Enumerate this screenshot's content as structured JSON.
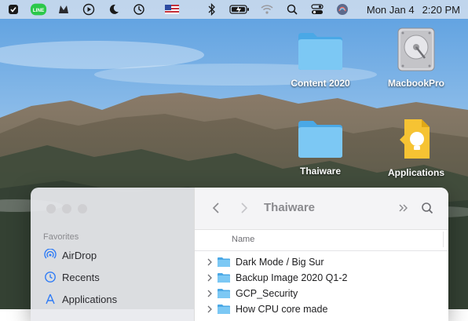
{
  "menubar": {
    "line_label": "LINE",
    "date": "Mon Jan 4",
    "time": "2:20 PM",
    "icons": [
      "checkbox-icon",
      "line-icon",
      "malwarebytes-icon",
      "play-icon",
      "moon-icon",
      "time-machine-icon",
      "flag-icon",
      "bluetooth-icon",
      "battery-icon",
      "wifi-icon",
      "search-icon",
      "control-center-icon",
      "siri-icon"
    ]
  },
  "desktop": {
    "icons": [
      {
        "label": "Content 2020",
        "icon": "folder-icon"
      },
      {
        "label": "MacbookPro",
        "icon": "hard-drive-icon"
      },
      {
        "label": "Thaiware",
        "icon": "folder-icon"
      },
      {
        "label": "Applications",
        "icon": "applications-icon"
      }
    ]
  },
  "finder": {
    "title": "Thaiware",
    "sidebar": {
      "section": "Favorites",
      "items": [
        {
          "label": "AirDrop",
          "icon": "airdrop-icon"
        },
        {
          "label": "Recents",
          "icon": "clock-icon"
        },
        {
          "label": "Applications",
          "icon": "applications-icon"
        }
      ]
    },
    "column_header": "Name",
    "rows": [
      {
        "name": "Dark Mode / Big Sur"
      },
      {
        "name": "Backup Image 2020 Q1-2"
      },
      {
        "name": "GCP_Security"
      },
      {
        "name": "How CPU core made"
      }
    ]
  },
  "colors": {
    "accent": "#2f7cf6",
    "folder": "#6cc2f2",
    "folder_dark": "#4aa8e6"
  }
}
